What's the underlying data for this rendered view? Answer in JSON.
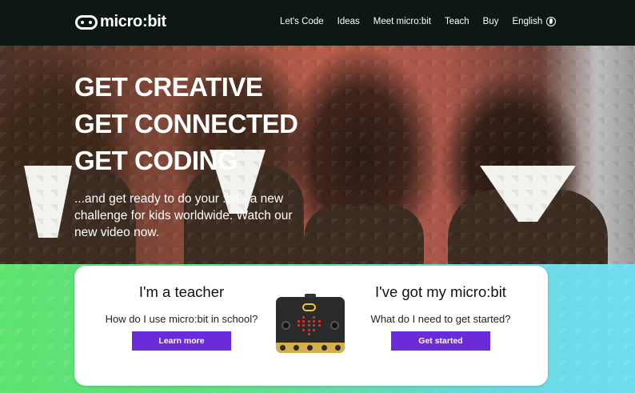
{
  "header": {
    "logo_text": "micro:bit",
    "nav": [
      {
        "label": "Let's Code"
      },
      {
        "label": "Ideas"
      },
      {
        "label": "Meet micro:bit"
      },
      {
        "label": "Teach"
      },
      {
        "label": "Buy"
      },
      {
        "label": "English"
      }
    ],
    "language_icon": "globe-icon"
  },
  "hero": {
    "headline": [
      "GET CREATIVE",
      "GET CONNECTED",
      "GET CODING"
    ],
    "subtext": "...and get ready to do your :bit - a new challenge for kids worldwide. Watch our new video now."
  },
  "cards": {
    "teacher": {
      "title": "I'm a teacher",
      "question": "How do I use micro:bit in school?",
      "button": "Learn more"
    },
    "owner": {
      "title": "I've got my micro:bit",
      "question": "What do I need to get started?",
      "button": "Get started"
    },
    "board_icon": "microbit-board-icon"
  },
  "colors": {
    "header_bg": "#0d1814",
    "button_bg": "#6c2bd9",
    "board_led": "#e32d2d",
    "band_start": "#5ce36f",
    "band_end": "#6fdcf0"
  }
}
